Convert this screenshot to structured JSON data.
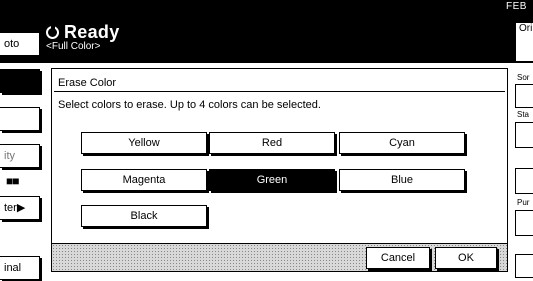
{
  "header": {
    "corner": "FEB",
    "status": "Ready",
    "mode": "<Full Color>"
  },
  "left_panel": {
    "items": [
      {
        "label": "oto"
      },
      {
        "label": ""
      },
      {
        "label": ""
      },
      {
        "label": "ity"
      },
      {
        "label": "■■"
      },
      {
        "label": "ter▶"
      },
      {
        "label": "inal"
      }
    ]
  },
  "right_panel": {
    "top_label": "Ori",
    "labels": [
      "Sor",
      "Sta",
      "Pur"
    ]
  },
  "dialog": {
    "title": "Erase Color",
    "instruction": "Select colors to erase. Up to 4 colors can be selected.",
    "colors": [
      {
        "label": "Yellow",
        "selected": false
      },
      {
        "label": "Red",
        "selected": false
      },
      {
        "label": "Cyan",
        "selected": false
      },
      {
        "label": "Magenta",
        "selected": false
      },
      {
        "label": "Green",
        "selected": true
      },
      {
        "label": "Blue",
        "selected": false
      },
      {
        "label": "Black",
        "selected": false
      }
    ],
    "cancel_label": "Cancel",
    "ok_label": "OK"
  }
}
